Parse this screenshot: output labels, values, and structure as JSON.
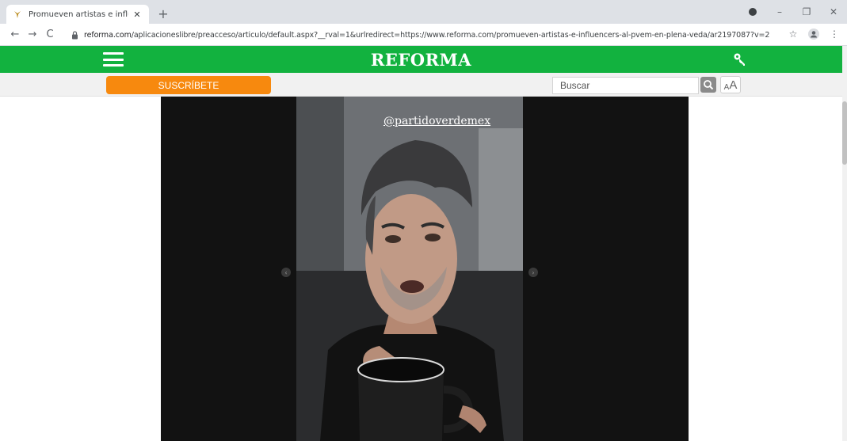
{
  "browser": {
    "tab_title": "Promueven artistas e influencers",
    "tab_close": "✕",
    "new_tab": "+",
    "url_host": "reforma.com",
    "url_path": "/aplicacioneslibre/preacceso/articulo/default.aspx?__rval=1&urlredirect=https://www.reforma.com/promueven-artistas-e-influencers-al-pvem-en-plena-veda/ar2197087?v=2",
    "back": "←",
    "forward": "→",
    "reload": "C",
    "minimize": "–",
    "restore": "❐",
    "close": "✕",
    "star": "☆",
    "menu": "⋮"
  },
  "site": {
    "logo": "REFORMA",
    "subscribe_label": "SUSCRÍBETE",
    "search_placeholder": "Buscar",
    "font_small": "A",
    "font_big": "A"
  },
  "media": {
    "handle": "@partidoverdemex",
    "prev_arrow": "‹",
    "next_arrow": "›"
  },
  "colors": {
    "brand_green": "#12b23f",
    "subscribe_orange": "#f7890e"
  }
}
